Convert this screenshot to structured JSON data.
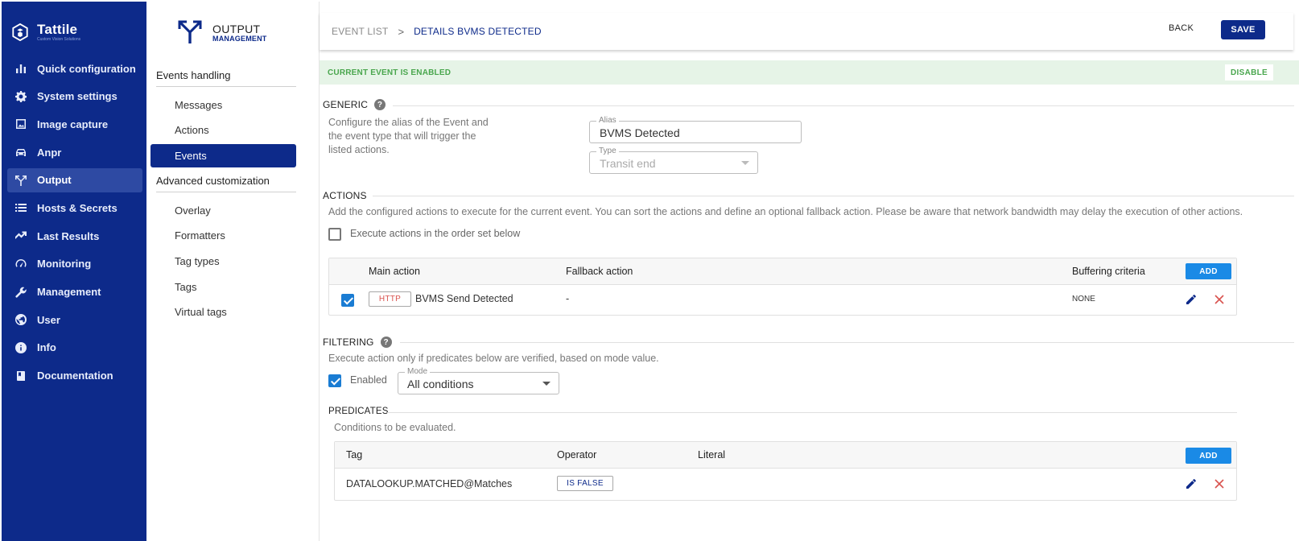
{
  "brand": {
    "name": "Tattile",
    "tagline": "Custom Vision Solutions"
  },
  "nav": {
    "items": [
      {
        "label": "Quick configuration",
        "icon": "bar-chart-icon",
        "active": false
      },
      {
        "label": "System settings",
        "icon": "gear-icon",
        "active": false
      },
      {
        "label": "Image capture",
        "icon": "image-icon",
        "active": false
      },
      {
        "label": "Anpr",
        "icon": "car-icon",
        "active": false
      },
      {
        "label": "Output",
        "icon": "split-arrow-icon",
        "active": true
      },
      {
        "label": "Hosts & Secrets",
        "icon": "list-icon",
        "active": false
      },
      {
        "label": "Last Results",
        "icon": "trend-icon",
        "active": false
      },
      {
        "label": "Monitoring",
        "icon": "gauge-icon",
        "active": false
      },
      {
        "label": "Management",
        "icon": "wrench-icon",
        "active": false
      },
      {
        "label": "User",
        "icon": "globe-icon",
        "active": false
      },
      {
        "label": "Info",
        "icon": "info-icon",
        "active": false
      },
      {
        "label": "Documentation",
        "icon": "book-icon",
        "active": false
      }
    ]
  },
  "subpanel": {
    "title": "OUTPUT",
    "subtitle": "MANAGEMENT",
    "section1": "Events handling",
    "section1_items": [
      "Messages",
      "Actions",
      "Events"
    ],
    "section2": "Advanced customization",
    "section2_items": [
      "Overlay",
      "Formatters",
      "Tag types",
      "Tags",
      "Virtual tags"
    ]
  },
  "topbar": {
    "crumb1": "EVENT LIST",
    "crumb_sep": ">",
    "crumb2": "DETAILS BVMS DETECTED",
    "back_label": "BACK",
    "save_label": "SAVE"
  },
  "status": {
    "text": "CURRENT EVENT IS ENABLED",
    "disable_label": "DISABLE"
  },
  "generic": {
    "title": "GENERIC",
    "help": "?",
    "desc_line1": "Configure the alias of the Event and",
    "desc_line2": "the event type that will trigger the",
    "desc_line3": "listed actions.",
    "alias_label": "Alias",
    "alias_value": "BVMS Detected",
    "type_label": "Type",
    "type_value": "Transit end"
  },
  "actions": {
    "title": "ACTIONS",
    "desc": "Add the configured actions to execute for the current event. You can sort the actions and define an optional fallback action. Please be aware that network bandwidth may delay the execution of other actions.",
    "order_label": "Execute actions in the order set below",
    "columns": {
      "main": "Main action",
      "fallback": "Fallback action",
      "buffer": "Buffering criteria"
    },
    "add_label": "ADD",
    "rows": [
      {
        "protocol": "HTTP",
        "name": "BVMS Send Detected",
        "fallback": "-",
        "buffer": "NONE"
      }
    ]
  },
  "filtering": {
    "title": "FILTERING",
    "help": "?",
    "desc": "Execute action only if predicates below are verified, based on mode value.",
    "enabled_label": "Enabled",
    "mode_label": "Mode",
    "mode_value": "All conditions"
  },
  "predicates": {
    "title": "PREDICATES",
    "desc": "Conditions to be evaluated.",
    "columns": {
      "tag": "Tag",
      "operator": "Operator",
      "literal": "Literal"
    },
    "add_label": "ADD",
    "rows": [
      {
        "tag": "DATALOOKUP.MATCHED@Matches",
        "operator": "IS FALSE",
        "literal": ""
      }
    ]
  },
  "colors": {
    "nav_bg": "#0d2a8a",
    "accent": "#1a8ae6",
    "success": "#49a64d",
    "danger": "#d9534f"
  }
}
